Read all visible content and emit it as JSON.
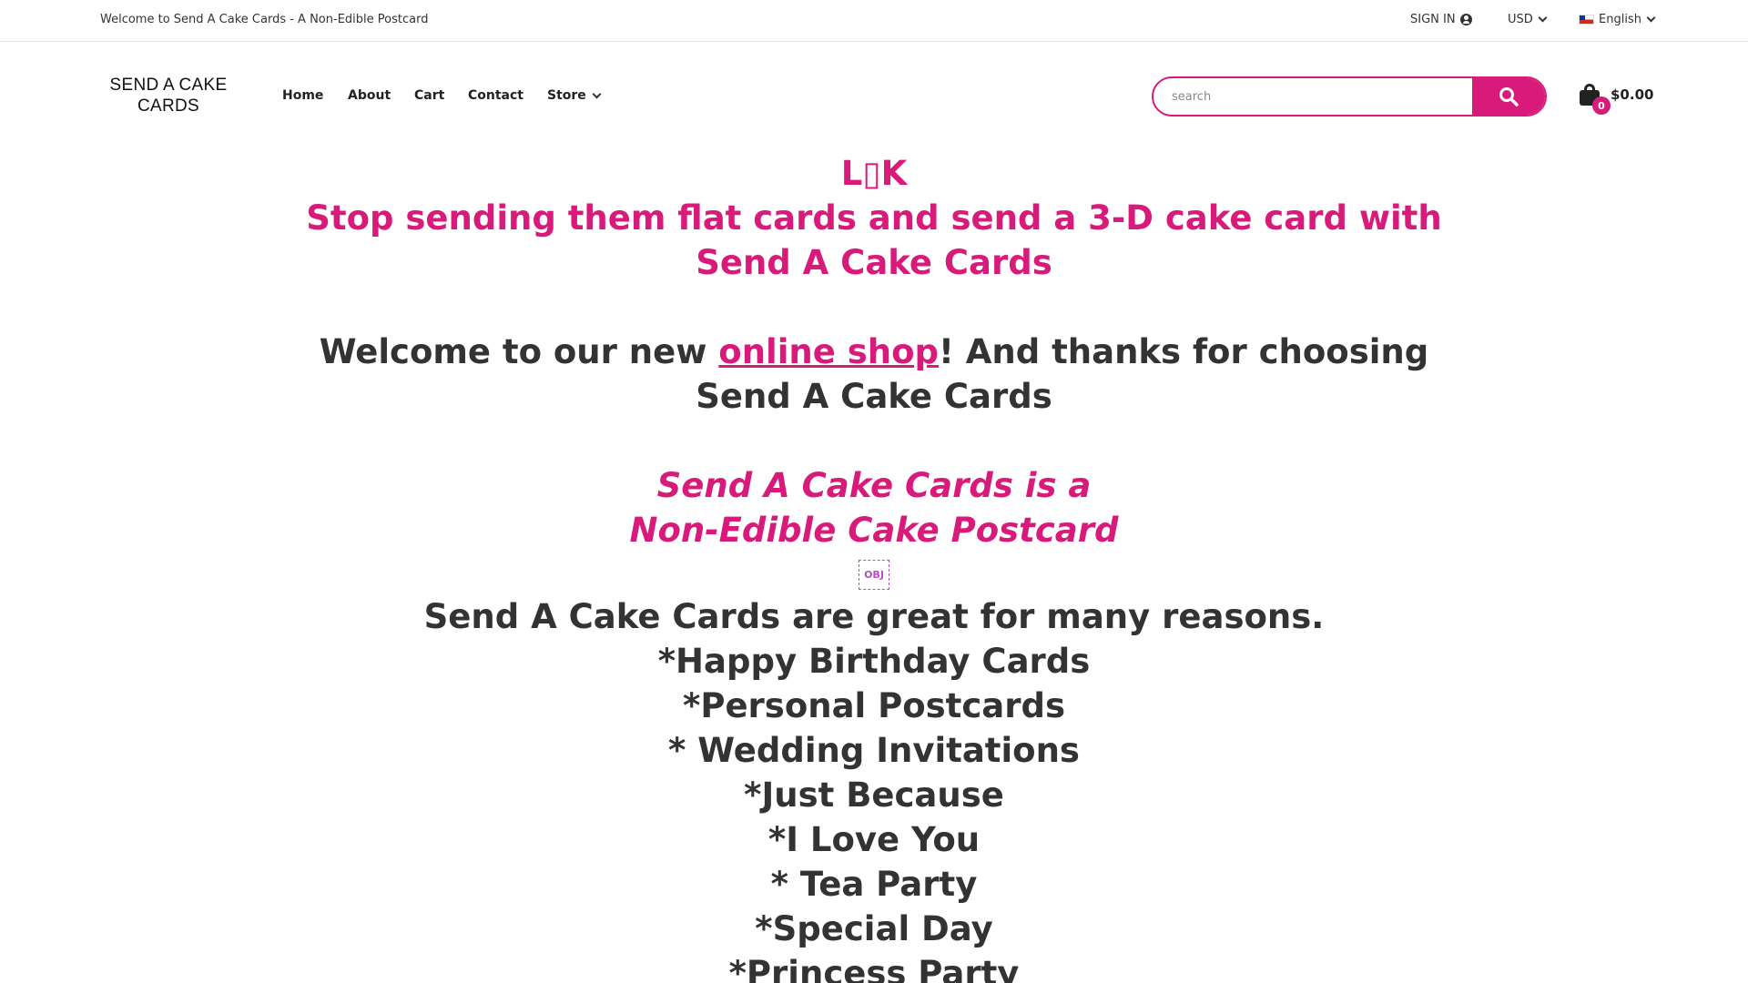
{
  "topbar": {
    "welcome": "Welcome to Send A Cake Cards - A Non-Edible Postcard",
    "sign_in": "SIGN IN",
    "currency": "USD",
    "language": "English"
  },
  "header": {
    "logo_line1": "SEND A CAKE",
    "logo_line2": "CARDS",
    "nav": {
      "home": "Home",
      "about": "About",
      "cart": "Cart",
      "contact": "Contact",
      "store": "Store"
    },
    "search": {
      "placeholder": "search"
    },
    "cart": {
      "count": "0",
      "total": "$0.00"
    }
  },
  "colors": {
    "accent": "#d81b7a",
    "text": "#333333"
  },
  "content": {
    "look": "L▯K",
    "tagline_1": "Stop sending them flat cards and send a 3-D cake card with",
    "tagline_2": "Send A Cake Cards",
    "welcome_pre": "Welcome to our new ",
    "welcome_link": "online shop",
    "welcome_post": "! And thanks for choosing",
    "welcome_2": "Send A Cake Cards",
    "is_a_1": "Send A Cake Cards is a",
    "is_a_2": "Non-Edible Cake Postcard",
    "obj": "OBJ",
    "reasons_title": "Send A Cake Cards are great for many reasons.",
    "reasons": [
      "*Happy Birthday Cards",
      "*Personal Postcards",
      "* Wedding Invitations",
      "*Just Because",
      "*I Love You",
      "* Tea Party",
      "*Special Day",
      "*Princess Party"
    ]
  }
}
